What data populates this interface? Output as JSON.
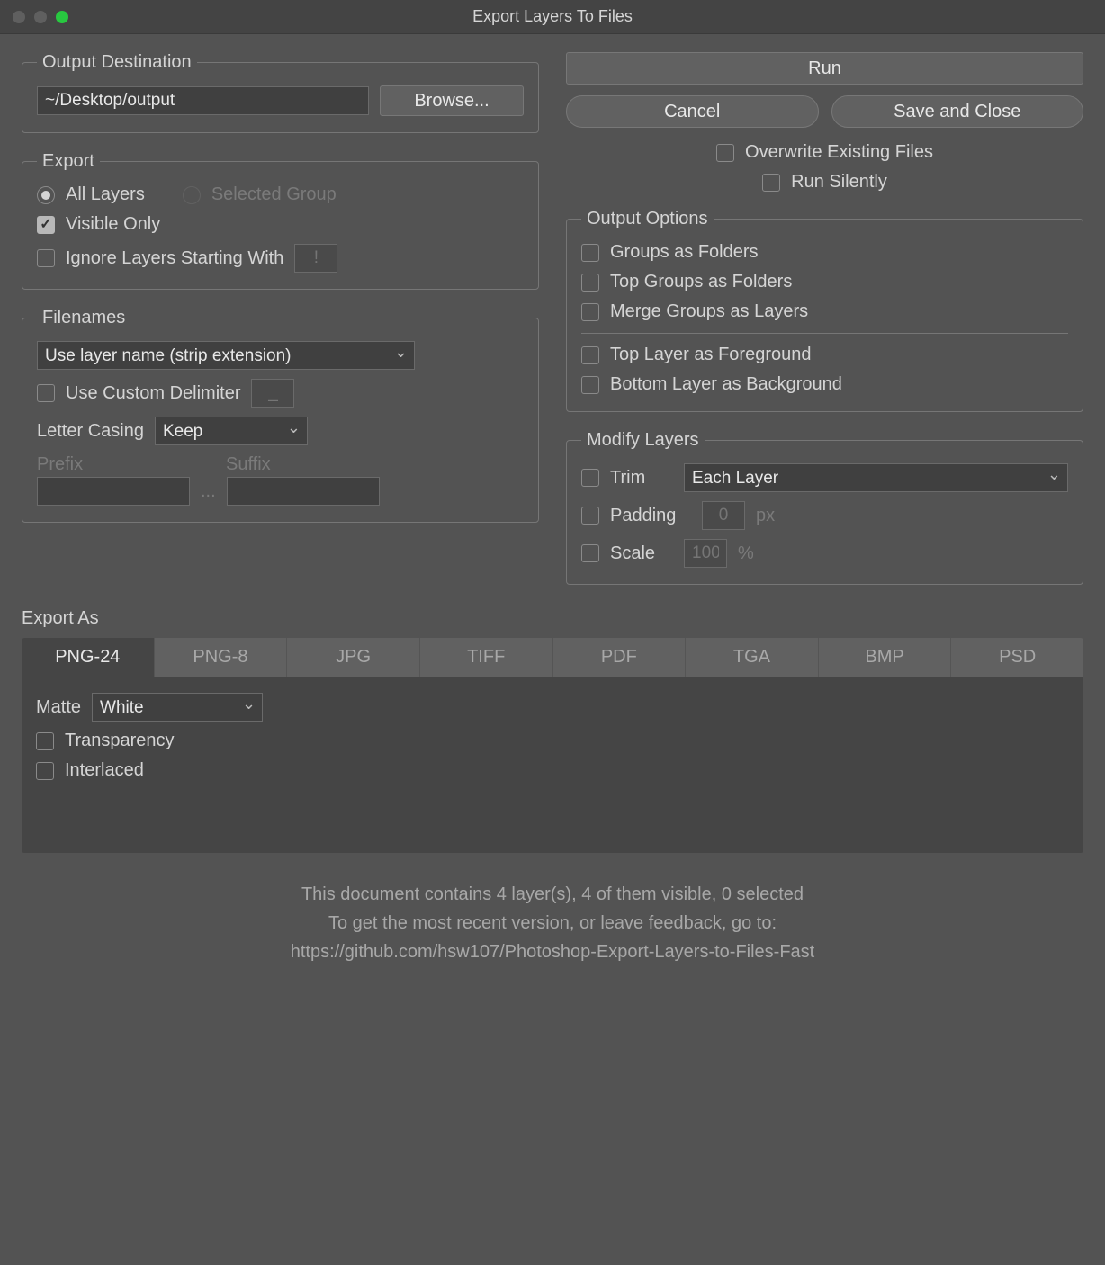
{
  "window": {
    "title": "Export Layers To Files"
  },
  "dest": {
    "legend": "Output Destination",
    "path": "~/Desktop/output",
    "browse": "Browse..."
  },
  "export": {
    "legend": "Export",
    "all": "All Layers",
    "selected": "Selected Group",
    "visible": "Visible Only",
    "ignore": "Ignore Layers Starting With",
    "ignore_placeholder": "!"
  },
  "filenames": {
    "legend": "Filenames",
    "naming": "Use layer name (strip extension)",
    "custom_delim": "Use Custom Delimiter",
    "delim_placeholder": "_",
    "letter_casing_label": "Letter Casing",
    "letter_casing": "Keep",
    "prefix_label": "Prefix",
    "suffix_label": "Suffix",
    "ellipsis": "..."
  },
  "actions": {
    "run": "Run",
    "cancel": "Cancel",
    "save_close": "Save and Close",
    "overwrite": "Overwrite Existing Files",
    "silent": "Run Silently"
  },
  "output_opts": {
    "legend": "Output Options",
    "groups_folders": "Groups as Folders",
    "top_groups_folders": "Top Groups as Folders",
    "merge_groups": "Merge Groups as Layers",
    "top_fg": "Top Layer as Foreground",
    "bottom_bg": "Bottom Layer as Background"
  },
  "modify": {
    "legend": "Modify Layers",
    "trim": "Trim",
    "trim_mode": "Each Layer",
    "padding": "Padding",
    "padding_val": "0",
    "padding_unit": "px",
    "scale": "Scale",
    "scale_val": "100",
    "scale_unit": "%"
  },
  "export_as": {
    "label": "Export As",
    "tabs": [
      "PNG-24",
      "PNG-8",
      "JPG",
      "TIFF",
      "PDF",
      "TGA",
      "BMP",
      "PSD"
    ],
    "matte_label": "Matte",
    "matte": "White",
    "transparency": "Transparency",
    "interlaced": "Interlaced"
  },
  "footer": {
    "line1": "This document contains 4 layer(s), 4 of them visible, 0 selected",
    "line2": "To get the most recent version, or leave feedback, go to:",
    "line3": "https://github.com/hsw107/Photoshop-Export-Layers-to-Files-Fast"
  }
}
